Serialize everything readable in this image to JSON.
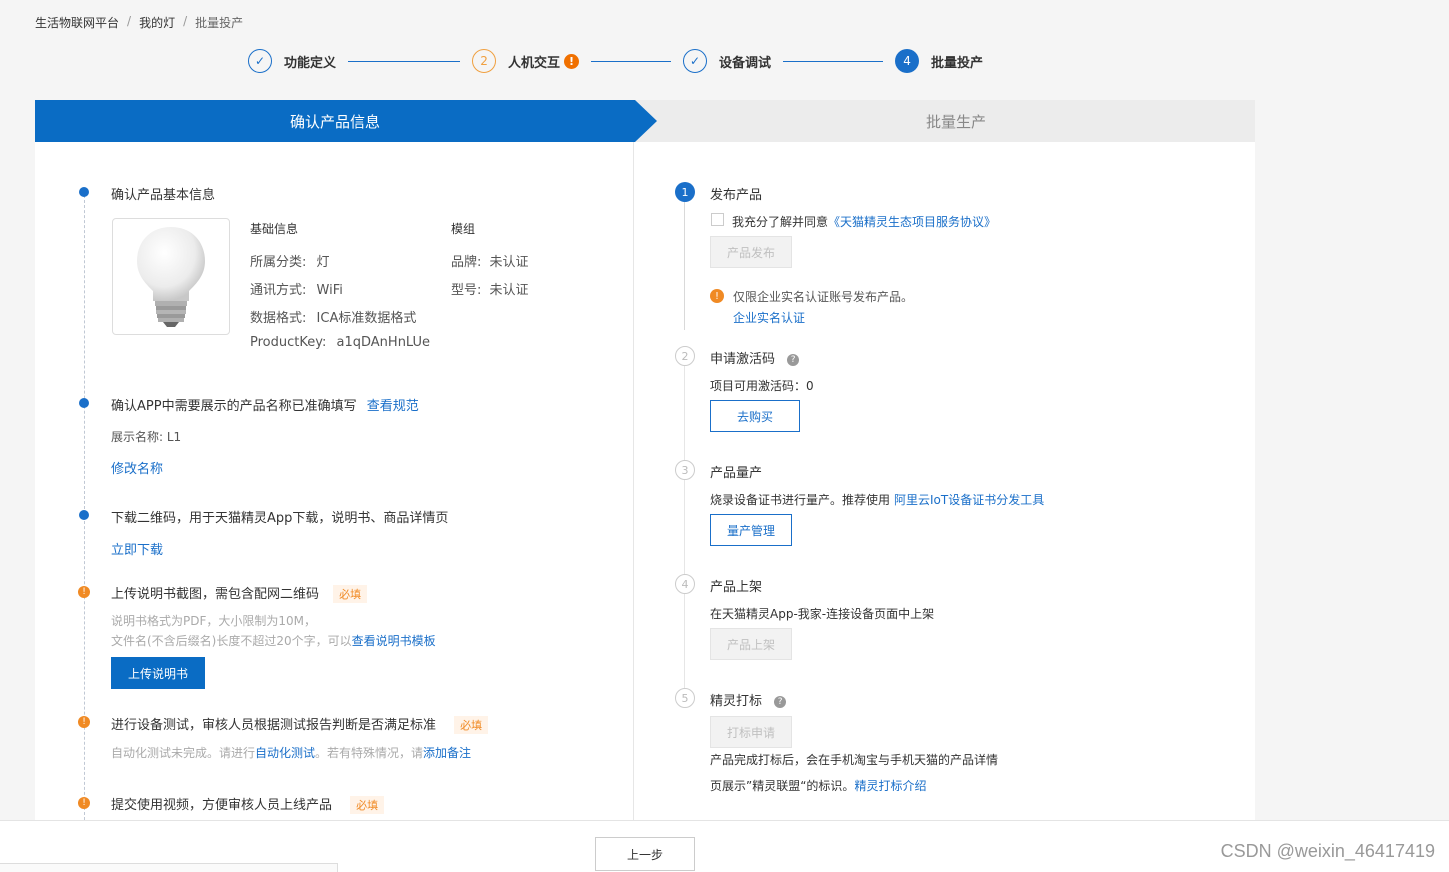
{
  "breadcrumb": {
    "item1": "生活物联网平台",
    "item2": "我的灯",
    "item3": "批量投产",
    "sep": "/"
  },
  "steps": [
    {
      "num": "✓",
      "label": "功能定义"
    },
    {
      "num": "2",
      "label": "人机交互",
      "warn": "!"
    },
    {
      "num": "✓",
      "label": "设备调试"
    },
    {
      "num": "4",
      "label": "批量投产"
    }
  ],
  "banner": {
    "left": "确认产品信息",
    "right": "批量生产"
  },
  "left": {
    "s1_title": "确认产品基本信息",
    "basic_header": "基础信息",
    "module_header": "模组",
    "category_label": "所属分类:",
    "category_value": "灯",
    "comm_label": "通讯方式:",
    "comm_value": "WiFi",
    "data_label": "数据格式:",
    "data_value": "ICA标准数据格式",
    "pk_label": "ProductKey:",
    "pk_value": "a1qDAnHnLUe",
    "brand_label": "品牌:",
    "brand_value": "未认证",
    "model_label": "型号:",
    "model_value": "未认证",
    "s2_title": "确认APP中需要展示的产品名称已准确填写",
    "s2_link": "查看规范",
    "display_name": "展示名称:  L1",
    "modify_name": "修改名称",
    "s3_title": "下载二维码，用于天猫精灵App下载，说明书、商品详情页",
    "s3_link": "立即下载",
    "s4_title": "上传说明书截图，需包含配网二维码",
    "required": "必填",
    "s4_hint1": "说明书格式为PDF，大小限制为10M，",
    "s4_hint2": "文件名(不含后缀名)长度不超过20个字，可以",
    "s4_hint_link": "查看说明书模板",
    "s4_button": "上传说明书",
    "s5_title": "进行设备测试，审核人员根据测试报告判断是否满足标准",
    "s5_hint_a": "自动化测试未完成。请进行",
    "s5_hint_link1": "自动化测试",
    "s5_hint_b": "。若有特殊情况，请",
    "s5_hint_link2": "添加备注",
    "s6_title": "提交使用视频，方便审核人员上线产品",
    "warn_mark": "!"
  },
  "right": {
    "r1_num": "1",
    "r1_title": "发布产品",
    "r1_agree": "我充分了解并同意",
    "r1_agree_link": "《天猫精灵生态项目服务协议》",
    "r1_button": "产品发布",
    "r1_warn_mark": "!",
    "r1_warn": "仅限企业实名认证账号发布产品。",
    "r1_warn_link": "企业实名认证",
    "r2_num": "2",
    "r2_title": "申请激活码",
    "r2_count": "项目可用激活码：0",
    "r2_button": "去购买",
    "r3_num": "3",
    "r3_title": "产品量产",
    "r3_desc": "烧录设备证书进行量产。推荐使用",
    "r3_link": "阿里云IoT设备证书分发工具",
    "r3_button": "量产管理",
    "r4_num": "4",
    "r4_title": "产品上架",
    "r4_desc": "在天猫精灵App-我家-连接设备页面中上架",
    "r4_button": "产品上架",
    "r5_num": "5",
    "r5_title": "精灵打标",
    "r5_button": "打标申请",
    "r5_desc1": "产品完成打标后，会在手机淘宝与手机天猫的产品详情",
    "r5_desc2": "页展示”精灵联盟“的标识。",
    "r5_link": "精灵打标介绍",
    "q_mark": "?"
  },
  "footer": {
    "prev": "上一步",
    "watermark": "CSDN @weixin_46417419"
  }
}
